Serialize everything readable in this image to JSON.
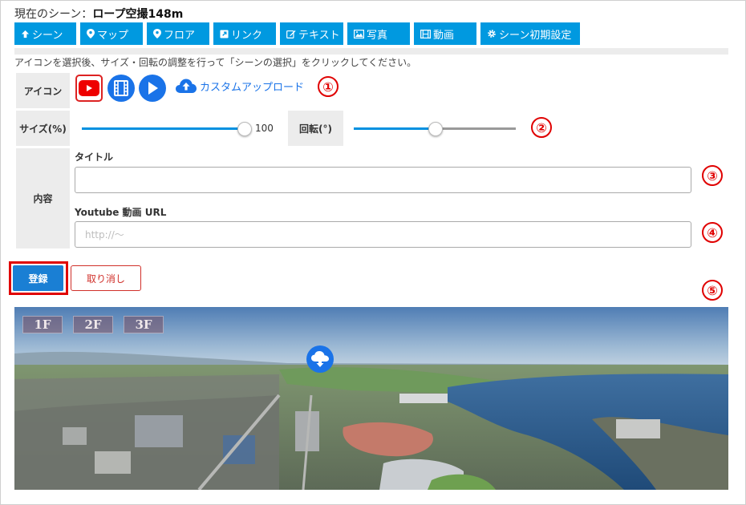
{
  "header": {
    "scene_prefix": "現在のシーン：",
    "scene_name": "ロープ空撮148m"
  },
  "tabs": [
    {
      "label": "シーン",
      "icon": "arrow-up-icon"
    },
    {
      "label": "マップ",
      "icon": "map-pin-icon"
    },
    {
      "label": "フロア",
      "icon": "map-pin-icon"
    },
    {
      "label": "リンク",
      "icon": "external-link-icon"
    },
    {
      "label": "テキスト",
      "icon": "edit-icon"
    },
    {
      "label": "写真",
      "icon": "image-icon"
    },
    {
      "label": "動画",
      "icon": "film-icon"
    },
    {
      "label": "シーン初期設定",
      "icon": "gear-icon"
    }
  ],
  "instruction": "アイコンを選択後、サイズ・回転の調整を行って「シーンの選択」をクリックしてください。",
  "form": {
    "icon_label": "アイコン",
    "custom_upload_label": "カスタムアップロード",
    "size_label": "サイズ(%)",
    "size_value": "100",
    "size_fraction": 1.0,
    "rotation_label": "回転(°)",
    "rotation_fraction": 0.5,
    "content_label": "内容",
    "title_label": "タイトル",
    "title_value": "",
    "url_label": "Youtube 動画 URL",
    "url_placeholder": "http://～",
    "register_button": "登録",
    "cancel_button": "取り消し"
  },
  "annotations": [
    "①",
    "②",
    "③",
    "④",
    "⑤"
  ],
  "panorama": {
    "floors": [
      "1F",
      "2F",
      "3F"
    ]
  },
  "colors": {
    "tab_blue": "#0099e0",
    "accent_red": "#e00000",
    "primary_button": "#1a7fd4",
    "icon_blue": "#1a73e8"
  }
}
